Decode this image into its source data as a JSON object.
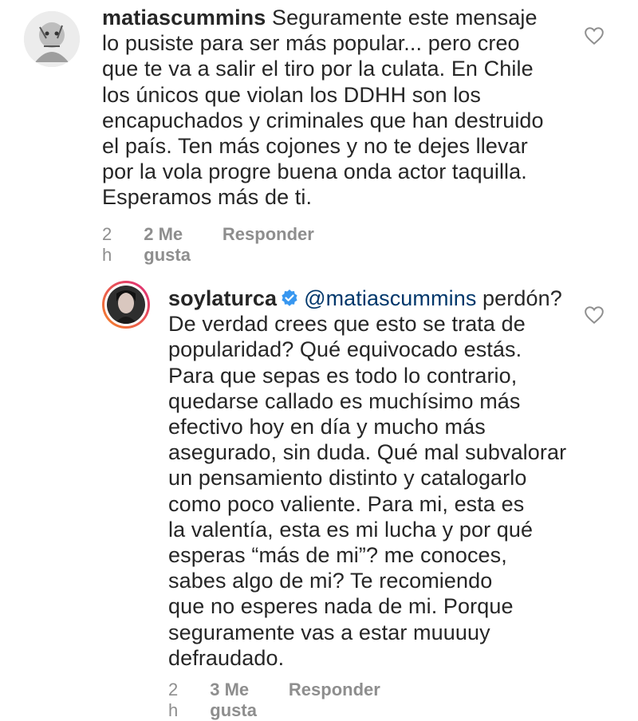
{
  "comments": [
    {
      "username": "matiascummins",
      "text": "Seguramente este mensaje\nlo pusiste para ser más popular... pero creo\nque te va a salir el tiro por la culata. En Chile\nlos únicos que violan los DDHH son los\nencapuchados y criminales que han destruido\nel país. Ten más cojones y no te dejes llevar\npor la vola progre buena onda actor taquilla.\nEsperamos más de ti.",
      "time": "2 h",
      "likes": "2 Me gusta",
      "reply_label": "Responder",
      "avatar_icon": "avatar-sketch-icon",
      "like_icon": "heart-outline-icon"
    },
    {
      "username": "soylaturca",
      "verified_icon": "verified-badge-icon",
      "mention": "@matiascummins",
      "text_first_line": "perdón?",
      "text": "De verdad crees que esto se trata de\npopularidad? Qué equivocado estás.\nPara que sepas es todo lo contrario,\nquedarse callado es muchísimo más\nefectivo hoy en día y mucho más\nasegurado, sin duda. Qué mal subvalorar\nun pensamiento distinto y catalogarlo\ncomo poco valiente. Para mi, esta es\nla valentía, esta es mi lucha y por qué\nesperas “más de mi”? me conoces,\nsabes algo de mi? Te recomiendo\nque no esperes nada de mi. Porque\nseguramente vas a estar muuuuy\ndefraudado.",
      "time": "2 h",
      "likes": "3 Me gusta",
      "reply_label": "Responder",
      "avatar_icon": "avatar-photo-icon",
      "like_icon": "heart-outline-icon",
      "colors": {
        "verified": "#3897f0",
        "mention": "#00376b",
        "story_ring": [
          "#f58529",
          "#dd2a7b"
        ]
      }
    }
  ]
}
